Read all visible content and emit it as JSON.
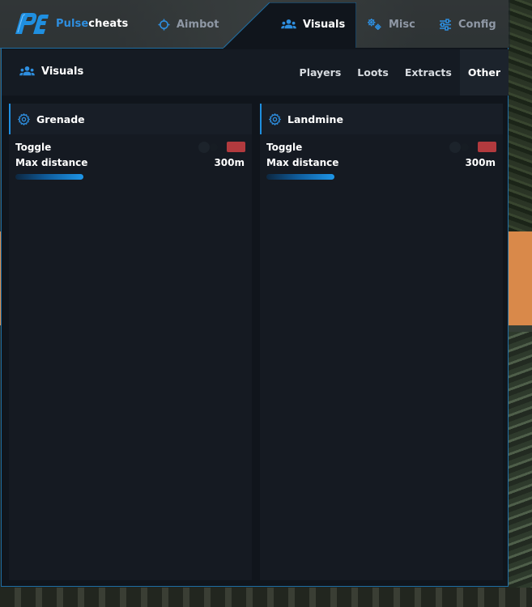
{
  "brand": {
    "prefix": "Pulse",
    "suffix": "cheats"
  },
  "nav": {
    "tabs": [
      {
        "label": "Aimbot",
        "icon": "crosshair-icon",
        "active": false
      },
      {
        "label": "Visuals",
        "icon": "users-icon",
        "active": true
      },
      {
        "label": "Misc",
        "icon": "gears-icon",
        "active": false
      },
      {
        "label": "Config",
        "icon": "sliders-icon",
        "active": false
      }
    ]
  },
  "section": {
    "title": "Visuals",
    "subtabs": [
      {
        "label": "Players",
        "active": false
      },
      {
        "label": "Loots",
        "active": false
      },
      {
        "label": "Extracts",
        "active": false
      },
      {
        "label": "Other",
        "active": true
      }
    ]
  },
  "cards": [
    {
      "title": "Grenade",
      "toggle_label": "Toggle",
      "toggle_color": "#b23a3e",
      "distance_label": "Max distance",
      "distance_value": "300m"
    },
    {
      "title": "Landmine",
      "toggle_label": "Toggle",
      "toggle_color": "#b23a3e",
      "distance_label": "Max distance",
      "distance_value": "300m"
    }
  ],
  "colors": {
    "accent": "#2e8fe0",
    "panel": "#10151c",
    "border": "#1f6ea3"
  }
}
